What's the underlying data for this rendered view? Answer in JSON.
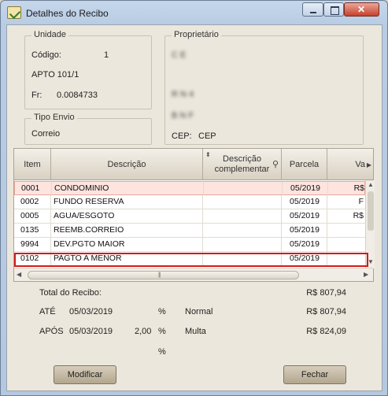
{
  "window": {
    "title": "Detalhes do Recibo"
  },
  "unidade": {
    "label": "Unidade",
    "codigo_label": "Código:",
    "codigo_value": "1",
    "apto": "APTO 101/1",
    "fr_label": "Fr:",
    "fr_value": "0.0084733"
  },
  "tipo_envio": {
    "label": "Tipo Envio",
    "value": "Correio"
  },
  "proprietario": {
    "label": "Proprietário",
    "name": "C        E",
    "addr1": "R        N       4",
    "addr2": "B        N       F",
    "cep_label": "CEP:",
    "cep_value": "CEP"
  },
  "grid": {
    "columns": [
      "Item",
      "Descrição",
      "Descrição complementar",
      "Parcela",
      "Va"
    ],
    "sort_icon": "sort-icon",
    "search_icon": "search-icon",
    "rows": [
      {
        "item": "0001",
        "descricao": "CONDOMINIO",
        "compl": "",
        "parcela": "05/2019",
        "valor": "R$"
      },
      {
        "item": "0002",
        "descricao": "FUNDO RESERVA",
        "compl": "",
        "parcela": "05/2019",
        "valor": "F"
      },
      {
        "item": "0005",
        "descricao": "AGUA/ESGOTO",
        "compl": "",
        "parcela": "05/2019",
        "valor": "R$"
      },
      {
        "item": "0135",
        "descricao": "REEMB.CORREIO",
        "compl": "",
        "parcela": "05/2019",
        "valor": ""
      },
      {
        "item": "9994",
        "descricao": "DEV.PGTO MAIOR",
        "compl": "",
        "parcela": "05/2019",
        "valor": ""
      },
      {
        "item": "0102",
        "descricao": "PAGTO A MENOR",
        "compl": "",
        "parcela": "05/2019",
        "valor": ""
      }
    ]
  },
  "totals": {
    "total_label": "Total do Recibo:",
    "total_value": "R$ 807,94",
    "ate_label": "ATÉ",
    "ate_date": "05/03/2019",
    "ate_pct": "%",
    "ate_type": "Normal",
    "ate_value": "R$ 807,94",
    "apos_label": "APÓS",
    "apos_date": "05/03/2019",
    "apos_rate": "2,00",
    "apos_pct": "%",
    "apos_type": "Multa",
    "apos_value": "R$ 824,09",
    "extra_pct": "%"
  },
  "buttons": {
    "modificar": "Modificar",
    "fechar": "Fechar"
  },
  "colors": {
    "highlight": "#d21a1a",
    "selected_row": "#fde4df"
  }
}
